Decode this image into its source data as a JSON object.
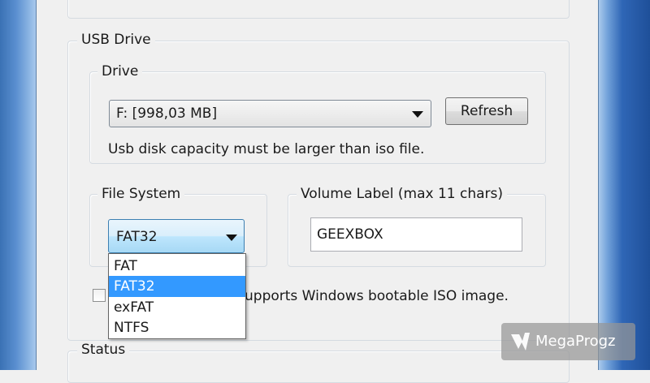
{
  "usb_drive": {
    "legend": "USB Drive",
    "drive": {
      "legend": "Drive",
      "selected": "F: [998,03 MB]",
      "refresh_label": "Refresh",
      "note": "Usb disk capacity must be larger than iso file."
    },
    "file_system": {
      "legend": "File System",
      "selected": "FAT32",
      "options": [
        "FAT",
        "FAT32",
        "exFAT",
        "NTFS"
      ],
      "highlighted_index": 1
    },
    "volume_label": {
      "legend": "Volume Label (max 11 chars)",
      "value": "GEEXBOX"
    },
    "checkbox_text": "upports Windows bootable ISO image."
  },
  "status": {
    "legend": "Status"
  },
  "watermark": {
    "text": "MegaProgz"
  },
  "colors": {
    "selection": "#3399ff",
    "combo_focus_top": "#e7f2fb",
    "combo_focus_bottom": "#a9d4f3"
  }
}
